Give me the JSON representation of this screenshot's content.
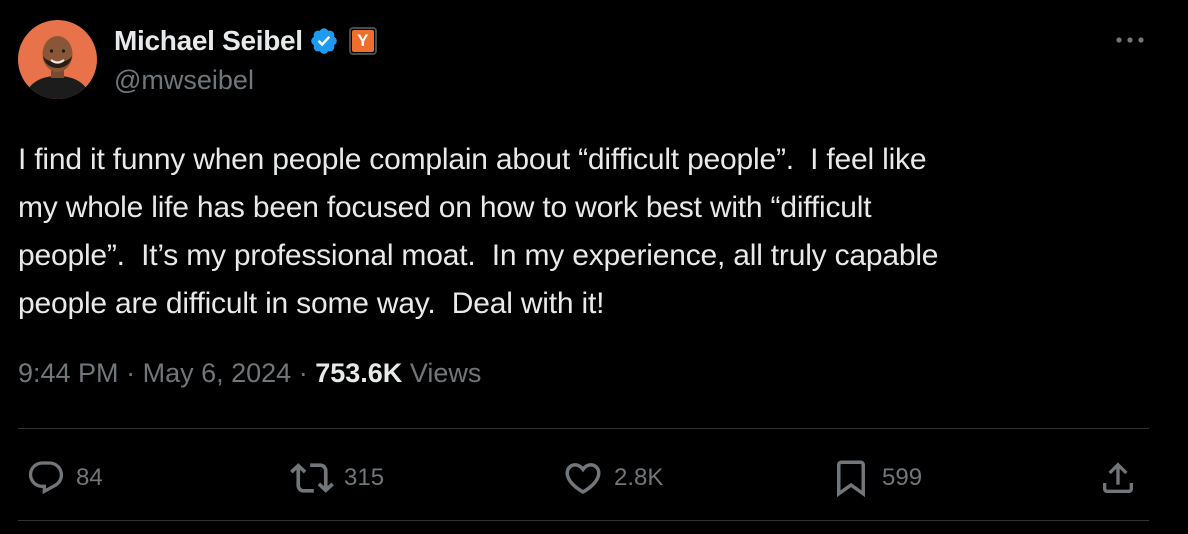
{
  "author": {
    "display_name": "Michael Seibel",
    "handle": "@mwseibel",
    "verified": true,
    "affiliation_badge_letter": "Y"
  },
  "tweet": {
    "text": "I find it funny when people complain about “difficult people”.  I feel like\nmy whole life has been focused on how to work best with “difficult\npeople”.  It’s my professional moat.  In my experience, all truly capable\npeople are difficult in some way.  Deal with it!",
    "time": "9:44 PM",
    "separator": "·",
    "date": "May 6, 2024",
    "views_count": "753.6K",
    "views_label": "Views"
  },
  "actions": {
    "replies": "84",
    "reposts": "315",
    "likes": "2.8K",
    "bookmarks": "599"
  },
  "icons": {
    "more": "more-horizontal-icon",
    "verified": "verified-badge-icon",
    "reply": "reply-bubble-icon",
    "repost": "repost-arrows-icon",
    "like": "heart-icon",
    "bookmark": "bookmark-icon",
    "share": "share-upload-icon"
  },
  "colors": {
    "background": "#000000",
    "primary_text": "#e7e9ea",
    "secondary_text": "#71767b",
    "verified_blue": "#1d9bf0",
    "divider": "#2f3336",
    "yc_orange": "#ee6f2d"
  }
}
